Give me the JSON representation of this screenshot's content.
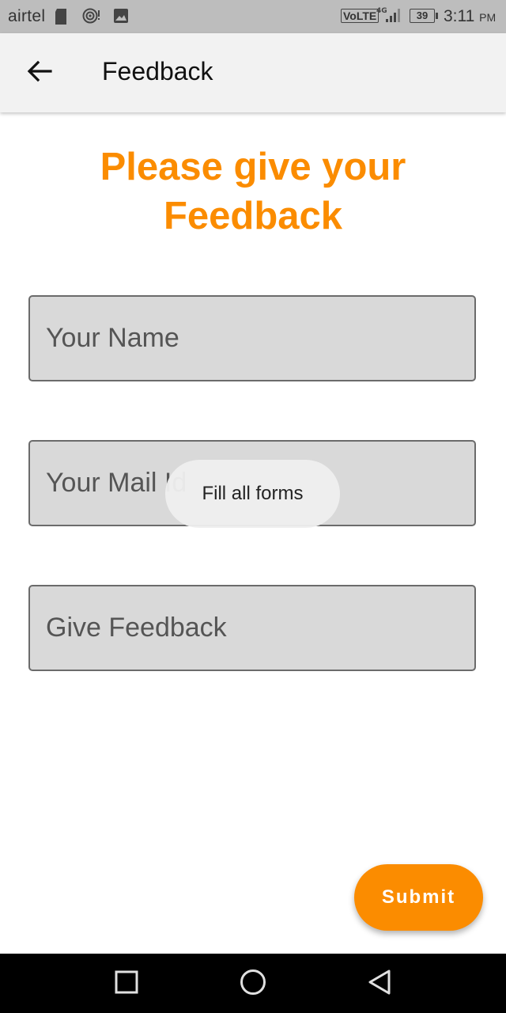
{
  "status_bar": {
    "carrier": "airtel",
    "icons": [
      "sd-card-icon",
      "hotspot-icon",
      "image-icon",
      "signal-icon"
    ],
    "network_label": "VoLTE",
    "network_type": "4G",
    "battery_level": "39",
    "time": "3:11",
    "time_suffix": "PM"
  },
  "app_bar": {
    "back_icon": "arrow-left-icon",
    "title": "Feedback"
  },
  "heading": {
    "line1": "Please give your",
    "line2": "Feedback"
  },
  "form": {
    "name_placeholder": "Your Name",
    "mail_placeholder": "Your Mail Id",
    "feedback_placeholder": "Give Feedback"
  },
  "toast": {
    "message": "Fill all forms"
  },
  "submit": {
    "label": "Submit"
  },
  "nav_bar": {
    "icons": [
      "recents-square-icon",
      "home-circle-icon",
      "back-triangle-icon"
    ]
  },
  "colors": {
    "accent": "#fb8c00",
    "field_background": "#d9d9d9",
    "app_bar_background": "#f2f2f2",
    "status_bar_background": "#bdbdbd"
  }
}
